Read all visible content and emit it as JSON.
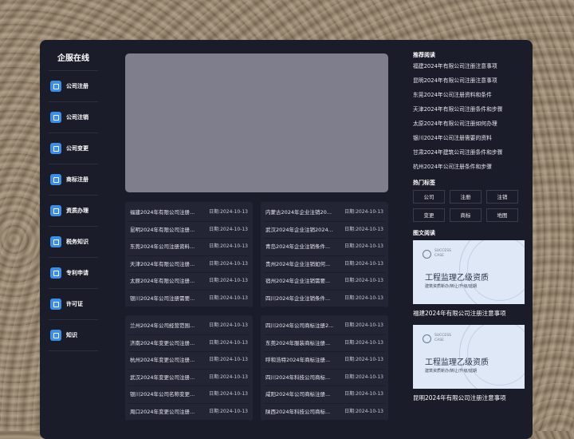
{
  "sidebar": {
    "brand": "企服在线",
    "items": [
      {
        "label": "公司注册"
      },
      {
        "label": "公司注销"
      },
      {
        "label": "公司变更"
      },
      {
        "label": "商标注册"
      },
      {
        "label": "资质办理"
      },
      {
        "label": "税务知识"
      },
      {
        "label": "专利申请"
      },
      {
        "label": "许可证"
      },
      {
        "label": "知识"
      }
    ]
  },
  "news": {
    "box1": [
      {
        "title": "福建2024年有限公司注册...",
        "date": "日期:2024-10-13"
      },
      {
        "title": "昆明2024年有限公司注册...",
        "date": "日期:2024-10-13"
      },
      {
        "title": "东莞2024年公司注册资料...",
        "date": "日期:2024-10-13"
      },
      {
        "title": "天津2024年有限公司注册...",
        "date": "日期:2024-10-13"
      },
      {
        "title": "太原2024年有限公司注册...",
        "date": "日期:2024-10-13"
      },
      {
        "title": "银川2024年公司注册需要...",
        "date": "日期:2024-10-13"
      }
    ],
    "box2": [
      {
        "title": "内蒙古2024年企业注销20...",
        "date": "日期:2024-10-13"
      },
      {
        "title": "武汉2024年企业注销2024...",
        "date": "日期:2024-10-13"
      },
      {
        "title": "青岛2024年企业注销条件...",
        "date": "日期:2024-10-13"
      },
      {
        "title": "贵州2024年企业注销如何...",
        "date": "日期:2024-10-13"
      },
      {
        "title": "宿州2024年企业注销需要...",
        "date": "日期:2024-10-13"
      },
      {
        "title": "四川2024年企业注销条件...",
        "date": "日期:2024-10-13"
      }
    ],
    "box3": [
      {
        "title": "兰州2024年公司经营范围...",
        "date": "日期:2024-10-13"
      },
      {
        "title": "济南2024年变更公司注册...",
        "date": "日期:2024-10-13"
      },
      {
        "title": "杭州2024年变更公司注册...",
        "date": "日期:2024-10-13"
      },
      {
        "title": "武汉2024年变更公司注册...",
        "date": "日期:2024-10-13"
      },
      {
        "title": "银川2024年公司名称变更...",
        "date": "日期:2024-10-13"
      },
      {
        "title": "周口2024年变更公司注册...",
        "date": "日期:2024-10-13"
      }
    ],
    "box4": [
      {
        "title": "四川2024年公司商标注册2...",
        "date": "日期:2024-10-13"
      },
      {
        "title": "东莞2024年服装商标注册...",
        "date": "日期:2024-10-13"
      },
      {
        "title": "呼和浩特2024年商标注册...",
        "date": "日期:2024-10-13"
      },
      {
        "title": "四川2024年科技公司商标...",
        "date": "日期:2024-10-13"
      },
      {
        "title": "咸阳2024年公司商标注册...",
        "date": "日期:2024-10-13"
      },
      {
        "title": "陕西2024年科技公司商标...",
        "date": "日期:2024-10-13"
      }
    ]
  },
  "right": {
    "recommend_title": "推荐阅读",
    "recommend": [
      "福建2024年有限公司注册注意事项",
      "昆明2024年有限公司注册注意事项",
      "东莞2024年公司注册资料和条件",
      "天津2024年有限公司注册条件和步骤",
      "太原2024年有限公司注册如何办理",
      "银川2024年公司注册需要的资料",
      "甘肃2024年建筑公司注册条件和步骤",
      "杭州2024年公司注册条件和步骤"
    ],
    "tags_title": "热门标签",
    "tags": [
      "公司",
      "注册",
      "注销",
      "变更",
      "商标",
      "地图"
    ],
    "pics_title": "图文阅读",
    "cards": [
      {
        "success1": "SUCCESS",
        "success2": "CASE",
        "title": "工程监理乙级资质",
        "sub": "建筑资质新办/转让/升级/延期",
        "caption": "福建2024年有限公司注册注意事项"
      },
      {
        "success1": "SUCCESS",
        "success2": "CASE",
        "title": "工程监理乙级资质",
        "sub": "建筑资质新办/转让/升级/延期",
        "caption": "昆明2024年有限公司注册注意事项"
      }
    ]
  }
}
